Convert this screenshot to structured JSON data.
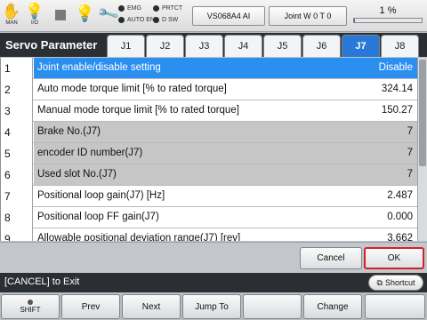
{
  "topbar": {
    "man_label": "MAN",
    "io_label": "I/O",
    "indicators": [
      "EMG",
      "PRTCT",
      "AUTO EN",
      "D SW"
    ],
    "robot_button": "VS068A4 AI",
    "joint_button": "Joint  W 0 T 0",
    "speed_percent": "1 %",
    "speed_value": 1
  },
  "title": "Servo Parameter",
  "tabs": [
    "J1",
    "J2",
    "J3",
    "J4",
    "J5",
    "J6",
    "J7",
    "J8"
  ],
  "active_tab": "J7",
  "rows": [
    {
      "idx": "1",
      "label": "Joint enable/disable setting",
      "value": "Disable"
    },
    {
      "idx": "2",
      "label": "Auto mode torque limit [% to rated torque]",
      "value": "324.14"
    },
    {
      "idx": "3",
      "label": "Manual mode torque limit [% to rated torque]",
      "value": "150.27"
    },
    {
      "idx": "4",
      "label": "Brake No.(J7)",
      "value": "7"
    },
    {
      "idx": "5",
      "label": "encoder ID number(J7)",
      "value": "7"
    },
    {
      "idx": "6",
      "label": "Used slot No.(J7)",
      "value": "7"
    },
    {
      "idx": "7",
      "label": "Positional loop gain(J7) [Hz]",
      "value": "2.487"
    },
    {
      "idx": "8",
      "label": "Positional loop FF gain(J7)",
      "value": "0.000"
    },
    {
      "idx": "9",
      "label": "Allowable positional deviation range(J7) [rev]",
      "value": "3.662"
    }
  ],
  "actions": {
    "cancel": "Cancel",
    "ok": "OK"
  },
  "status": {
    "message": "[CANCEL] to Exit",
    "shortcut": "Shortcut"
  },
  "fkeys": {
    "shift": "SHIFT",
    "f1": "Prev",
    "f2": "Next",
    "f3": "Jump To",
    "f4": "",
    "f5": "Change",
    "f6": ""
  }
}
